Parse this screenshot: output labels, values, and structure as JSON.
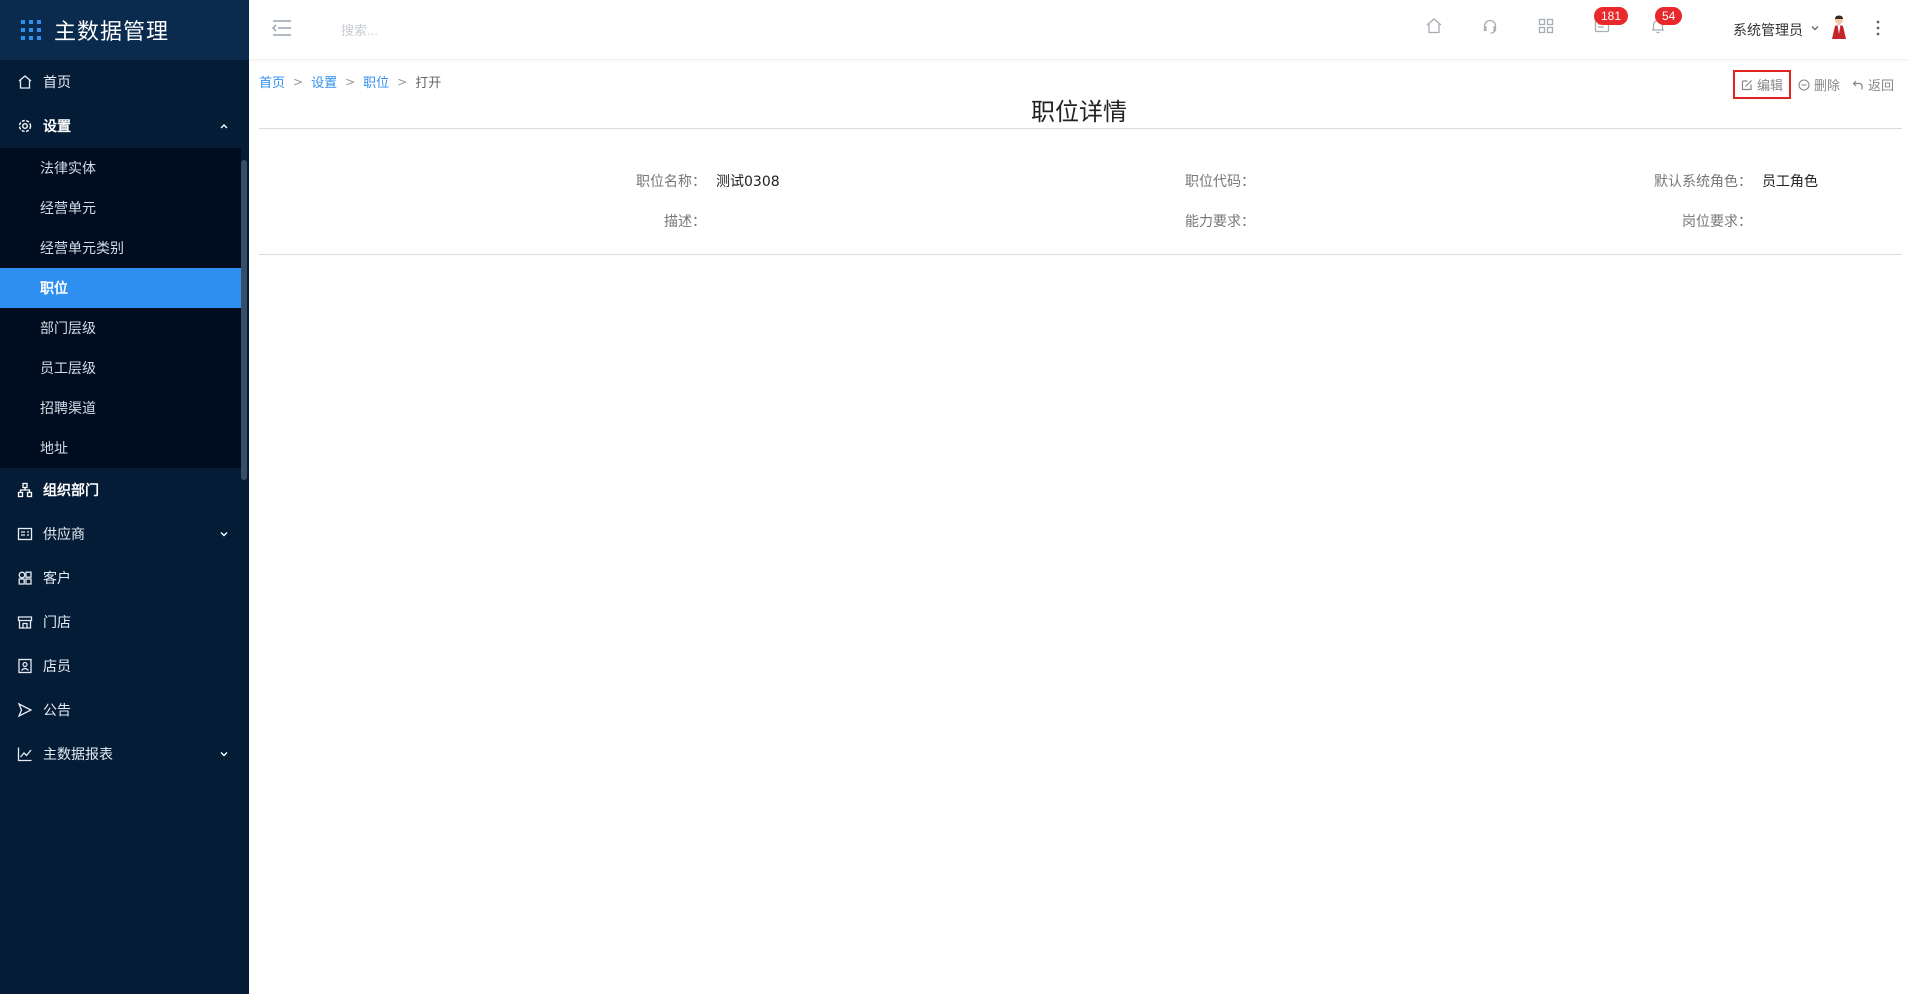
{
  "app": {
    "title": "主数据管理"
  },
  "sidebar": {
    "items": [
      {
        "label": "首页",
        "icon": "home-icon"
      },
      {
        "label": "设置",
        "icon": "gear-icon",
        "expanded": true,
        "children": [
          "法律实体",
          "经营单元",
          "经营单元类别",
          "职位",
          "部门层级",
          "员工层级",
          "招聘渠道",
          "地址"
        ],
        "selected": "职位"
      },
      {
        "label": "组织部门",
        "icon": "org-chart-icon"
      },
      {
        "label": "供应商",
        "icon": "supplier-icon",
        "has_children": true
      },
      {
        "label": "客户",
        "icon": "customer-icon"
      },
      {
        "label": "门店",
        "icon": "store-icon"
      },
      {
        "label": "店员",
        "icon": "clerk-icon"
      },
      {
        "label": "公告",
        "icon": "announcement-icon"
      },
      {
        "label": "主数据报表",
        "icon": "chart-icon",
        "has_children": true
      }
    ]
  },
  "topbar": {
    "search_placeholder": "搜索...",
    "messages_badge": "181",
    "notifications_badge": "54",
    "user_name": "系统管理员"
  },
  "breadcrumb": {
    "items": [
      "首页",
      "设置",
      "职位"
    ],
    "current": "打开",
    "separator": ">"
  },
  "actions": {
    "edit": "编辑",
    "delete": "删除",
    "back": "返回"
  },
  "page": {
    "title": "职位详情",
    "fields": {
      "name_label": "职位名称：",
      "name_value": "测试0308",
      "code_label": "职位代码：",
      "code_value": "",
      "role_label": "默认系统角色：",
      "role_value": "员工角色",
      "desc_label": "描述：",
      "desc_value": "",
      "ability_label": "能力要求：",
      "ability_value": "",
      "post_label": "岗位要求：",
      "post_value": ""
    }
  },
  "colors": {
    "sidebar_bg": "#051c37",
    "sidebar_header_bg": "#0a2a4e",
    "submenu_bg": "#000c1f",
    "accent": "#2f8ff0",
    "badge": "#e8282b",
    "edit_highlight": "#e32222"
  }
}
